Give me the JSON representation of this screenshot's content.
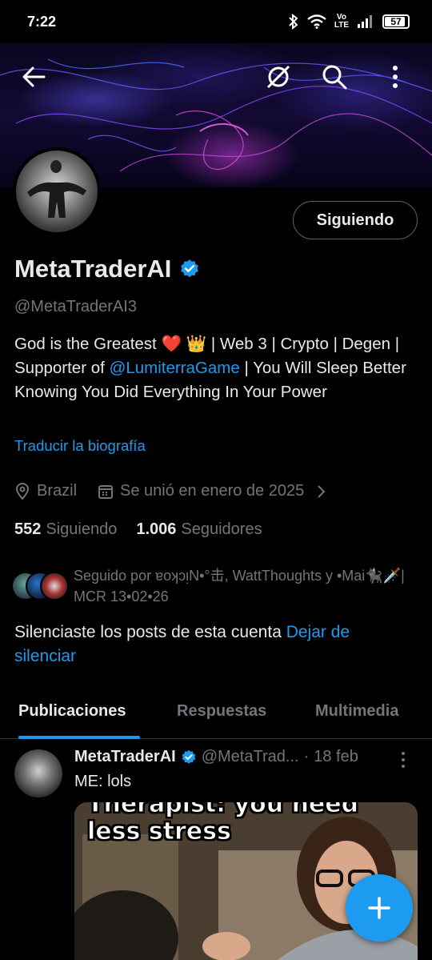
{
  "status_bar": {
    "time": "7:22",
    "battery": "57",
    "network": "Vo\nLTE"
  },
  "profile": {
    "display_name": "MetaTraderAI",
    "handle": "@MetaTraderAI3",
    "follow_button": "Siguiendo",
    "bio_part1": "God is the Greatest ❤️ 👑 | Web 3 | Crypto | Degen | Supporter of ",
    "bio_link": "@LumiterraGame",
    "bio_part2": " | You Will Sleep Better Knowing You Did Everything In Your Power",
    "translate_bio": "Traducir la biografía",
    "location": "Brazil",
    "joined": "Se unió en enero de 2025",
    "following_count": "552",
    "following_label": "Siguiendo",
    "followers_count": "1.006",
    "followers_label": "Seguidores",
    "followed_by": "Seguido por ɐoʞɔᴉN•°击, WattThoughts y •Mai🐈‍⬛🗡️| MCR 13•02•26",
    "muted_text": "Silenciaste los posts de esta cuenta ",
    "unmute_link": "Dejar de silenciar"
  },
  "tabs": [
    "Publicaciones",
    "Respuestas",
    "Multimedia"
  ],
  "post": {
    "name": "MetaTraderAI",
    "handle": "@MetaTrad...",
    "separator": "·",
    "date": "18 feb",
    "text": "ME: lols",
    "meme_caption": "Therapist: you need less stress"
  },
  "colors": {
    "accent": "#1d9bf0",
    "background": "#000000",
    "secondary_text": "#71767b"
  },
  "icons": [
    "back-arrow-icon",
    "grok-icon",
    "search-icon",
    "more-vertical-icon",
    "verified-badge-icon",
    "location-pin-icon",
    "calendar-icon",
    "chevron-right-icon",
    "compose-plus-icon"
  ]
}
